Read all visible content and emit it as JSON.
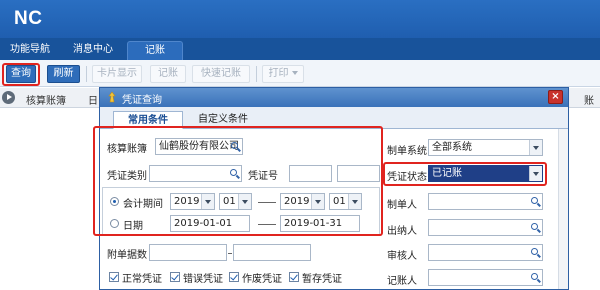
{
  "app": {
    "logo": "NC",
    "main_tabs": [
      "功能导航",
      "消息中心",
      "记账"
    ],
    "toolbar": {
      "query": "查询",
      "refresh": "刷新",
      "card_print": "卡片显示",
      "bookkeep": "记账",
      "quick_bookkeep": "快速记账",
      "print": "打印"
    },
    "grid": {
      "col_account": "核算账簿",
      "col_partial": "日",
      "col_right_partial": "账"
    }
  },
  "dialog": {
    "title": "凭证查询",
    "close": "×",
    "tabs": [
      "常用条件",
      "自定义条件"
    ],
    "left": {
      "account_label": "核算账簿",
      "account_value": "仙鹤股份有限公司",
      "voucher_type_label": "凭证类别",
      "voucher_type_value": "",
      "voucher_no_label": "凭证号",
      "voucher_no_from": "",
      "voucher_no_to": "",
      "period_label": "会计期间",
      "period_from_year": "2019",
      "period_from_month": "01",
      "period_to_year": "2019",
      "period_to_month": "01",
      "date_label": "日期",
      "date_from": "2019-01-01",
      "date_to": "2019-01-31",
      "attachments_label": "附单据数",
      "attachments_from": "",
      "attachments_to": "",
      "checks": [
        {
          "label": "正常凭证",
          "checked": true
        },
        {
          "label": "错误凭证",
          "checked": true
        },
        {
          "label": "作废凭证",
          "checked": true
        },
        {
          "label": "暂存凭证",
          "checked": true
        }
      ]
    },
    "right": {
      "system_label": "制单系统",
      "system_value": "全部系统",
      "status_label": "凭证状态",
      "status_value": "已记账",
      "maker_label": "制单人",
      "cashier_label": "出纳人",
      "auditor_label": "审核人",
      "bookkeeper_label": "记账人"
    }
  },
  "colors": {
    "brand_blue": "#1f5eaf",
    "highlight_red": "#e0241f",
    "selection_navy": "#1f3f87"
  }
}
